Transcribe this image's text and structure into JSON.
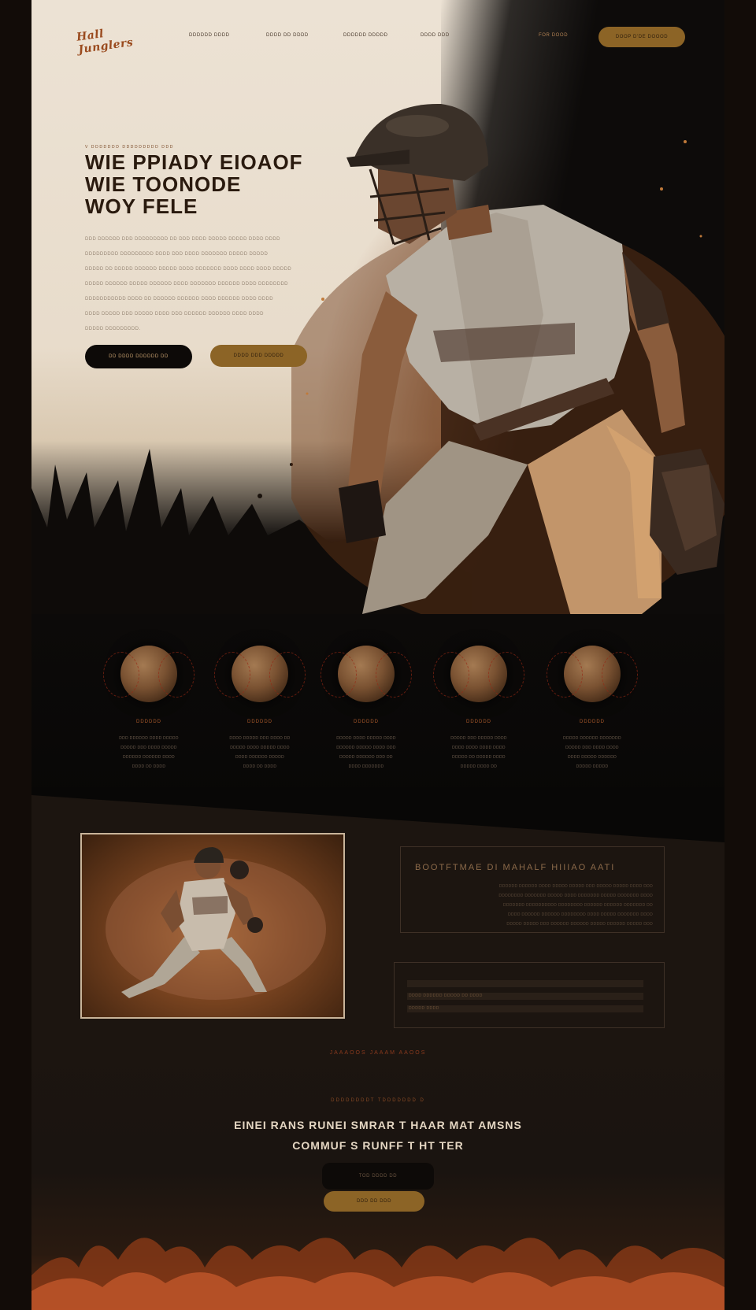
{
  "brand": {
    "logo_text": "Hall Junglers"
  },
  "nav": {
    "links": [
      "DDDDDD DDDD",
      "DDDD DD DDDD",
      "DDDDDD DDDDD",
      "DDDD DDD"
    ],
    "sign_in": "FOR DOOD",
    "cta": "DOOP D'DE DOOOD"
  },
  "hero": {
    "eyebrow": "V DDDDDDD DDDDDDDDD DDD",
    "title_lines": [
      "WIE PPIADY EIOAOF",
      "WIE TOONODE",
      "WOY FELE"
    ],
    "body_lines": [
      "DDD DDDDDD DDD DDDDDDDDD DD DDD DDDD DDDDD DDDDD DDDD DDDD",
      "DDDDDDDDD DDDDDDDDD DDDD DDD DDDD DDDDDDD DDDDD DDDDD",
      "DDDDD DD DDDDD DDDDDD DDDDD DDDD DDDDDDD DDDD DDDD DDDD DDDDD",
      "DDDDD DDDDDD DDDDD DDDDDD DDDD DDDDDDD DDDDDD DDDD DDDDDDDD",
      "DDDDDDDDDDD DDDD DD DDDDDD DDDDDD DDDD DDDDDD DDDD DDDD",
      "DDDD DDDDD DDD DDDDD DDDD DDD DDDDDD DDDDDD DDDD DDDD",
      "DDDDD DDDDDDDDD."
    ],
    "primary_button": "DD DDDD DDDDDD DD",
    "secondary_button": "DDDD DDD DDDDD"
  },
  "features": [
    {
      "title": "DDDDDD",
      "desc": [
        "DDD DDDDDD DDDD DDDDD",
        "DDDDD DDD DDDD DDDDD",
        "DDDDDD DDDDDD DDDD",
        "DDDD DD DDDD"
      ]
    },
    {
      "title": "DDDDDD",
      "desc": [
        "DDDD DDDDD DDD DDDD DD",
        "DDDDD DDDD DDDDD DDDD",
        "DDDD DDDDDD DDDDD",
        "DDDD DD DDDD"
      ]
    },
    {
      "title": "DDDDDD",
      "desc": [
        "DDDDD DDDD DDDDD DDDD",
        "DDDDDD DDDDD DDDD DDD",
        "DDDDD DDDDDD DDD DD",
        "DDDD DDDDDDD"
      ]
    },
    {
      "title": "DDDDDD",
      "desc": [
        "DDDDD DDD DDDDD DDDD",
        "DDDD DDDD DDDD DDDD",
        "DDDDD DD DDDDD DDDD",
        "DDDDD DDDD DD"
      ]
    },
    {
      "title": "DDDDDD",
      "desc": [
        "DDDDD DDDDDD DDDDDDD",
        "DDDDD DDD DDDD DDDD",
        "DDDD DDDDD DDDDDD",
        "DDDDD DDDDD"
      ]
    }
  ],
  "showcase": {
    "info_title": "BOOTFTMAE DI MAHALF HIIIAO AATI",
    "info_lines": [
      "DDDDDD DDDDDD DDDD DDDDD DDDDD DDD DDDDD DDDDD DDDD DDD",
      "DDDDDDDD DDDDDDD DDDDD DDDD DDDDDDD DDDDD DDDDDDD DDDD",
      "DDDDDDD DDDDDDDDDD DDDDDDDD DDDDDD DDDDDD DDDDDDD DD",
      "DDDD DDDDDD DDDDDD DDDDDDDD DDDD DDDDD DDDDDDD DDDD",
      "DDDDD DDDDD DDD DDDDDD DDDDDD DDDDD DDDDDD DDDDD DDD"
    ],
    "stats": [
      "",
      "DDDD DDDDDD DDDDD DD DDDD",
      "DDDDD     DDDD"
    ]
  },
  "cta": {
    "section_label": "JAAAOOS JAAAM AAOOS",
    "eyebrow": "DDDDDDDDT  TDDDDDDD D",
    "title_lines": [
      "EINEI RANS RUNEI SMRAR T HAAR MAT AMSNS",
      "COMMUF S RUNFF T HT TER"
    ],
    "button_dark": "TOD DDDD DD",
    "button_gold": "DDD DD DDD"
  },
  "colors": {
    "accent": "#8c6426",
    "rust": "#a8582a",
    "ink": "#2a1a0e",
    "cream": "#ece2d4"
  }
}
